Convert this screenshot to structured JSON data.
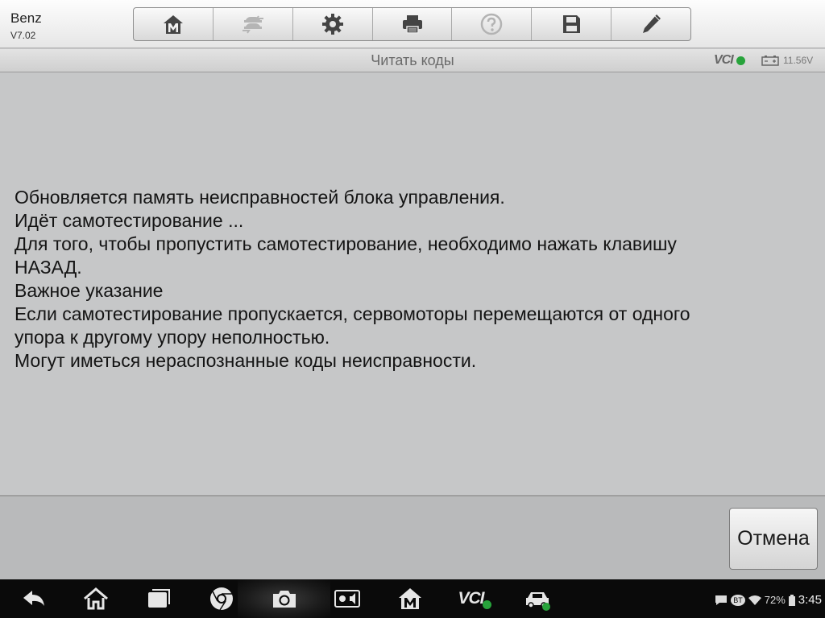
{
  "header": {
    "brand": "Benz",
    "version": "V7.02"
  },
  "toolbar": {
    "buttons": [
      {
        "icon": "home-m-icon"
      },
      {
        "icon": "vehicle-swap-icon"
      },
      {
        "icon": "gear-icon"
      },
      {
        "icon": "printer-icon"
      },
      {
        "icon": "help-icon"
      },
      {
        "icon": "save-icon"
      },
      {
        "icon": "pencil-icon"
      }
    ]
  },
  "titlebar": {
    "title": "Читать коды",
    "vci_label": "VCI",
    "voltage": "11.56V"
  },
  "message": {
    "lines": [
      "Обновляется память неисправностей блока управления.",
      "Идёт самотестирование ...",
      "Для того, чтобы пропустить самотестирование, необходимо нажать клавишу",
      "НАЗАД.",
      "Важное указание",
      "Если самотестирование пропускается, сервомоторы перемещаются от одного",
      "упора к другому упору неполностью.",
      "Могут иметься нераспознанные коды неисправности."
    ]
  },
  "actions": {
    "cancel_label": "Отмена"
  },
  "navbar": {
    "vci_label": "VCI",
    "bt_label": "BT",
    "battery_percent": "72%",
    "time": "3:45"
  },
  "colors": {
    "status_ok": "#27a33b",
    "content_bg": "#c6c7c8"
  }
}
